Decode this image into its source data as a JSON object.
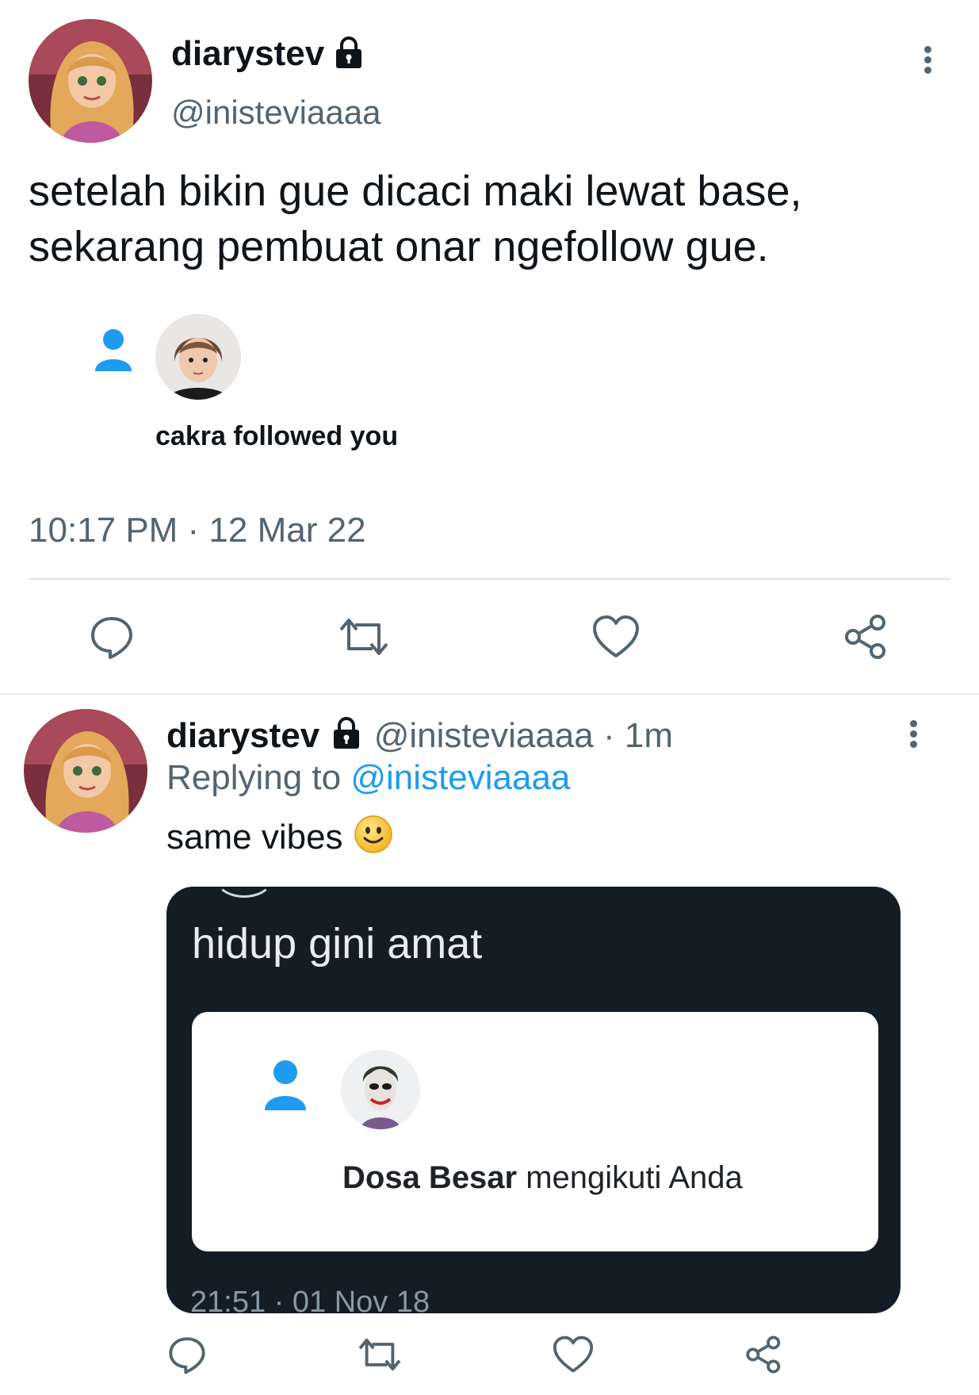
{
  "tweet": {
    "display_name": "diarystev",
    "handle": "@inisteviaaaa",
    "text_line1": "setelah bikin gue dicaci maki lewat base,",
    "text_line2": "sekarang pembuat onar ngefollow gue.",
    "notification": {
      "actor": "cakra",
      "action": " followed you"
    },
    "timestamp": "10:17 PM · 12 Mar 22"
  },
  "reply": {
    "display_name": "diarystev",
    "handle": "@inisteviaaaa",
    "time": " · 1m",
    "replying_prefix": "Replying to ",
    "replying_handle": "@inisteviaaaa",
    "text": "same vibes",
    "embedded": {
      "title": "hidup gini amat",
      "actor": "Dosa Besar",
      "action": " mengikuti Anda",
      "timestamp": "21:51 · 01 Nov 18"
    }
  },
  "colors": {
    "accent": "#1d9bf0",
    "muted": "#536471",
    "embed_bg": "#141d26"
  },
  "icons": [
    "lock-icon",
    "more-icon",
    "person-icon",
    "reply-icon",
    "retweet-icon",
    "like-icon",
    "share-icon",
    "smile-emoji"
  ]
}
